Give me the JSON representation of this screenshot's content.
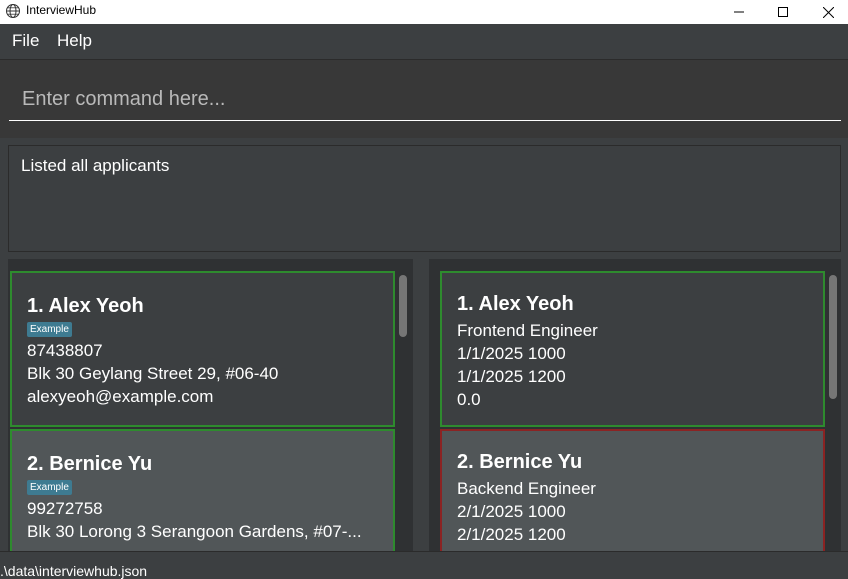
{
  "window": {
    "title": "InterviewHub"
  },
  "menu": {
    "file": "File",
    "help": "Help"
  },
  "command": {
    "placeholder": "Enter command here..."
  },
  "result": {
    "text": "Listed all applicants"
  },
  "applicants": [
    {
      "name": "1.  Alex Yeoh",
      "tag": "Example",
      "phone": "87438807",
      "address": "Blk 30 Geylang Street 29, #06-40",
      "email": "alexyeoh@example.com"
    },
    {
      "name": "2.  Bernice Yu",
      "tag": "Example",
      "phone": "99272758",
      "address": "Blk 30 Lorong 3 Serangoon Gardens, #07-..."
    }
  ],
  "interviews": [
    {
      "name": "1.  Alex Yeoh",
      "role": "Frontend Engineer",
      "start": "1/1/2025 1000",
      "end": "1/1/2025 1200",
      "rating": "0.0"
    },
    {
      "name": "2.  Bernice Yu",
      "role": "Backend Engineer",
      "start": "2/1/2025 1000",
      "end": "2/1/2025 1200"
    }
  ],
  "status": {
    "path": ".\\data\\interviewhub.json"
  },
  "colors": {
    "green_border": "#2e8b2e",
    "red_border": "#8b2323",
    "tag_bg": "#3e7b91"
  }
}
